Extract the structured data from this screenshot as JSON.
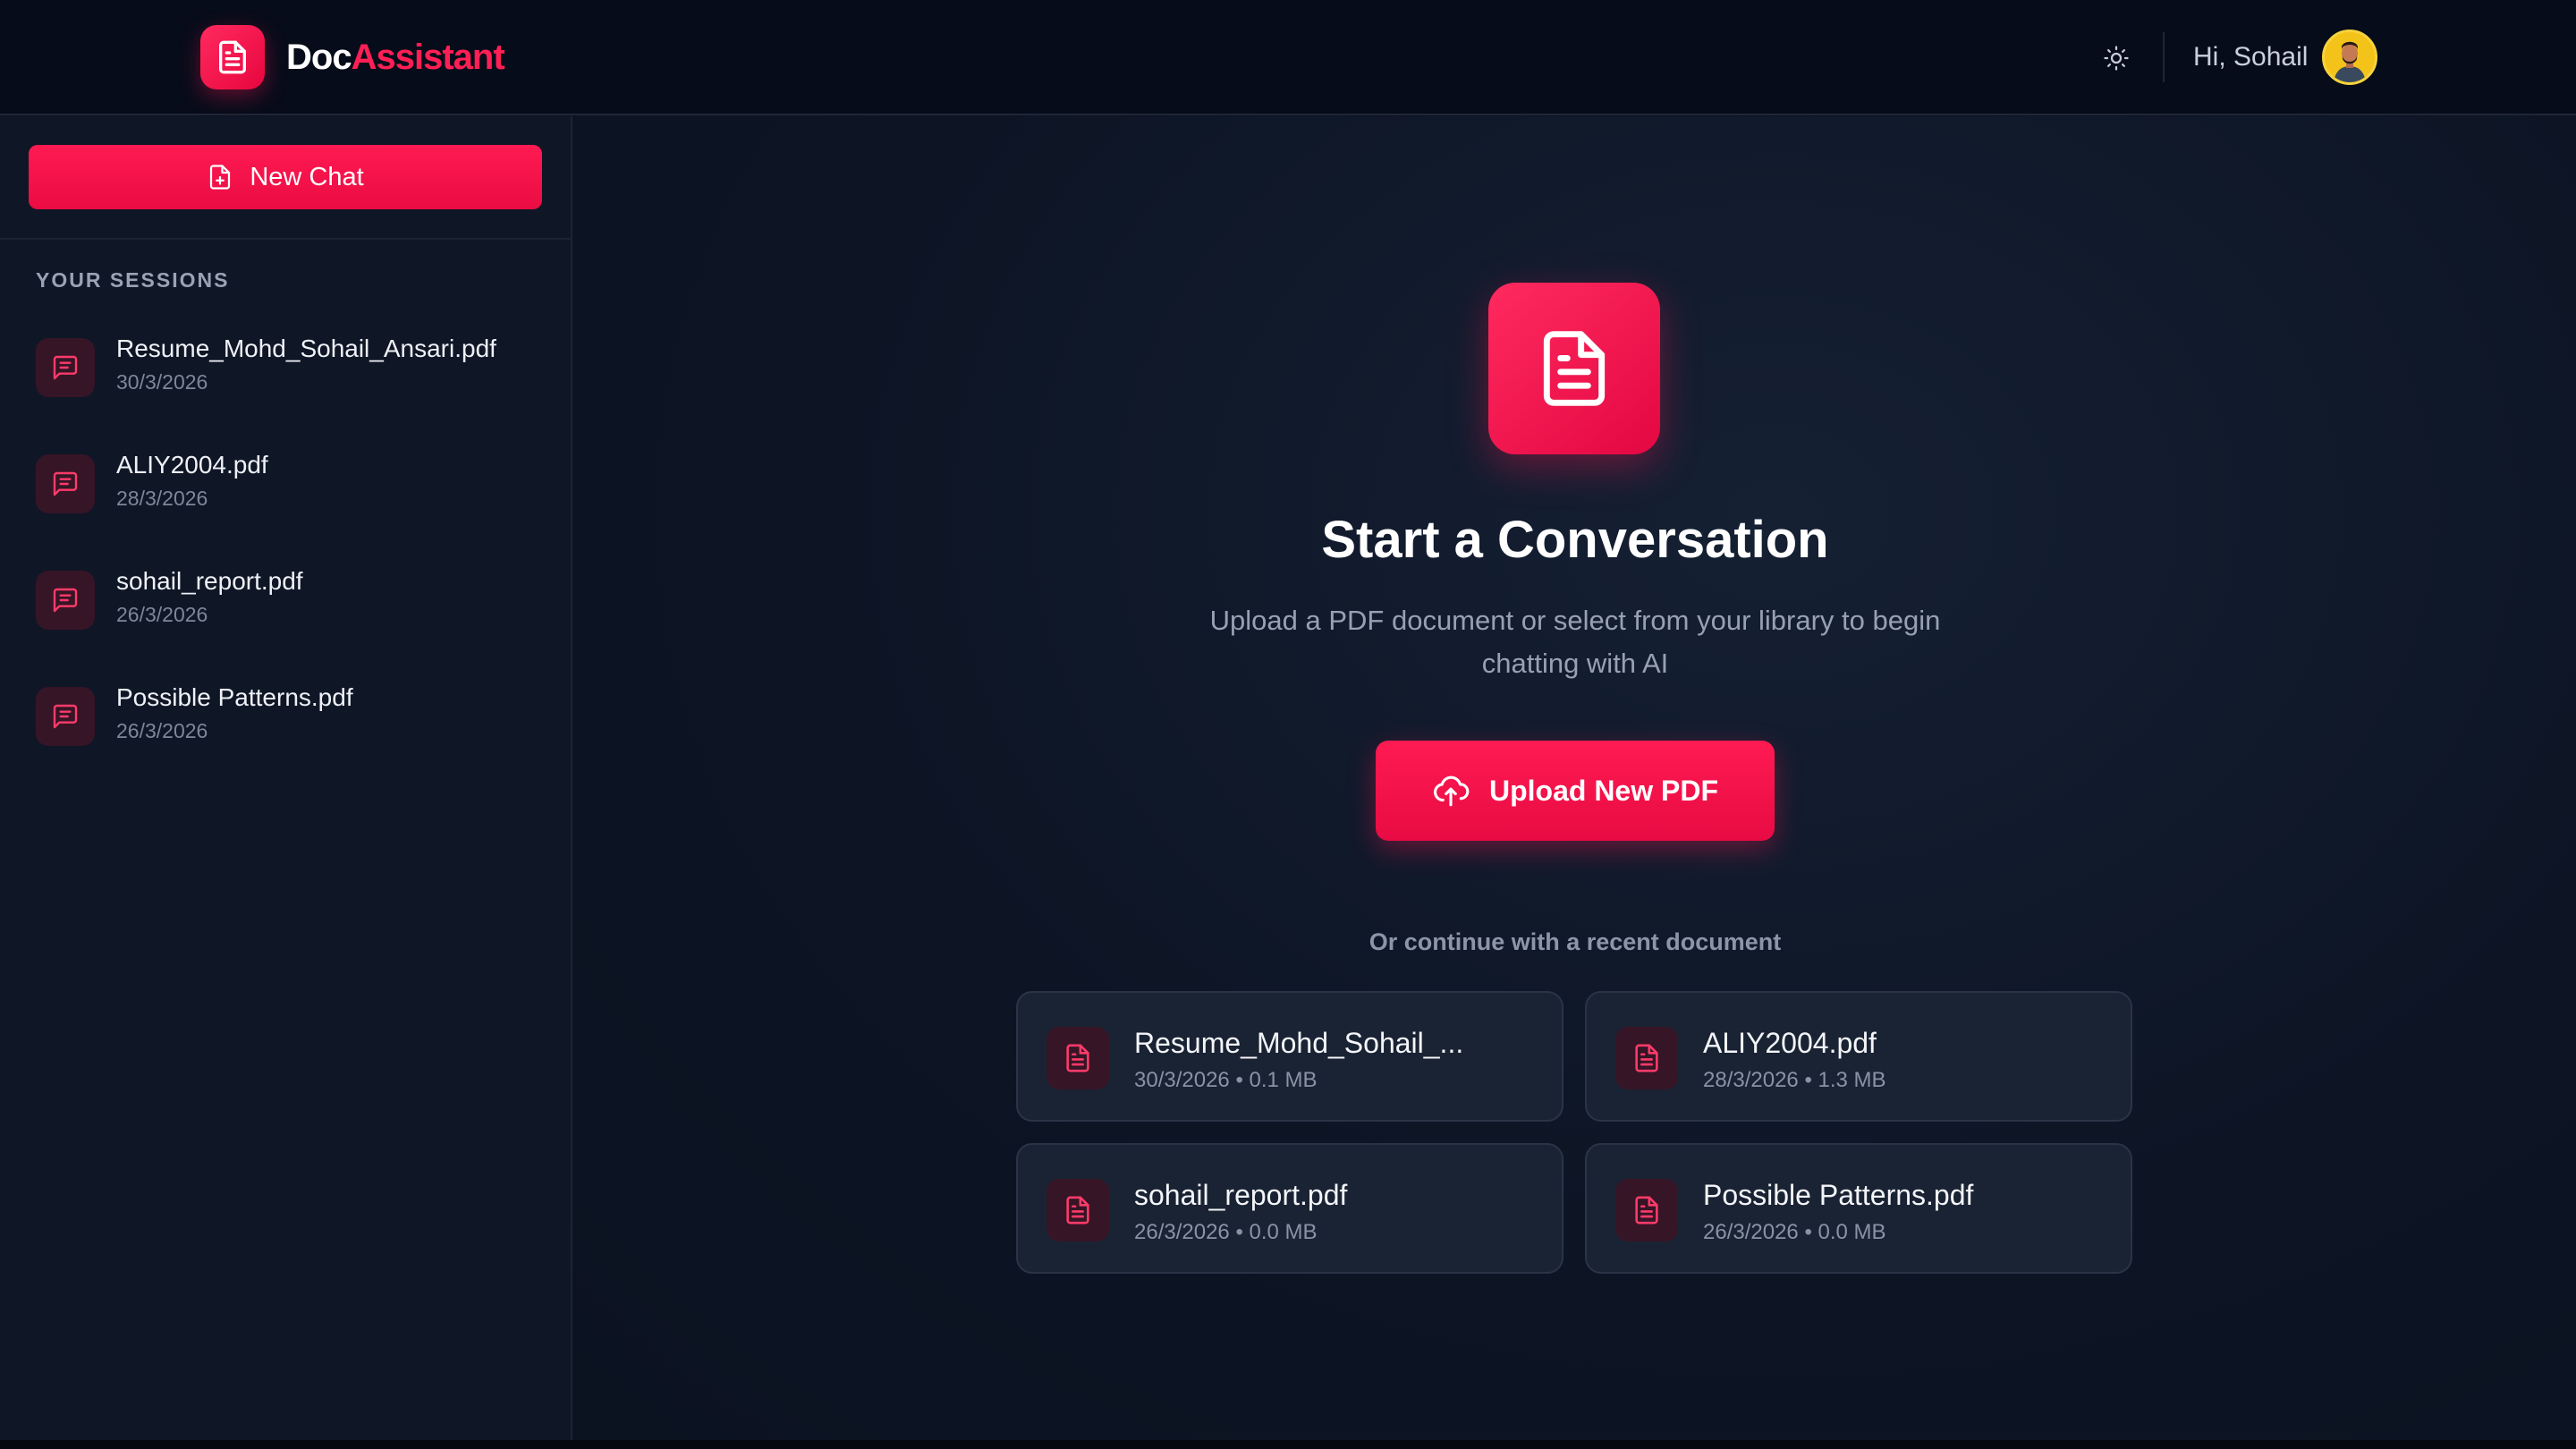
{
  "header": {
    "brand_part1": "Doc",
    "brand_part2": "Assistant",
    "greeting": "Hi, Sohail"
  },
  "sidebar": {
    "new_chat_label": "New Chat",
    "sessions_title": "YOUR SESSIONS",
    "sessions": [
      {
        "name": "Resume_Mohd_Sohail_Ansari.pdf",
        "date": "30/3/2026"
      },
      {
        "name": "ALIY2004.pdf",
        "date": "28/3/2026"
      },
      {
        "name": "sohail_report.pdf",
        "date": "26/3/2026"
      },
      {
        "name": "Possible Patterns.pdf",
        "date": "26/3/2026"
      }
    ]
  },
  "main": {
    "title": "Start a Conversation",
    "subtitle": "Upload a PDF document or select from your library to begin chatting with AI",
    "upload_label": "Upload New PDF",
    "recent_label": "Or continue with a recent document",
    "recent_docs": [
      {
        "name": "Resume_Mohd_Sohail_...",
        "meta": "30/3/2026 • 0.1 MB"
      },
      {
        "name": "ALIY2004.pdf",
        "meta": "28/3/2026 • 1.3 MB"
      },
      {
        "name": "sohail_report.pdf",
        "meta": "26/3/2026 • 0.0 MB"
      },
      {
        "name": "Possible Patterns.pdf",
        "meta": "26/3/2026 • 0.0 MB"
      }
    ]
  },
  "icons": {
    "logo": "document-icon",
    "theme": "sun-icon",
    "new_chat": "file-plus-icon",
    "session": "message-square-icon",
    "upload": "cloud-upload-icon",
    "doc": "document-icon"
  },
  "colors": {
    "accent": "#ff1a52",
    "background": "#0c1322",
    "header_bg": "#070c1a",
    "sidebar_bg": "#0f1626",
    "card_bg": "#1a2333"
  }
}
